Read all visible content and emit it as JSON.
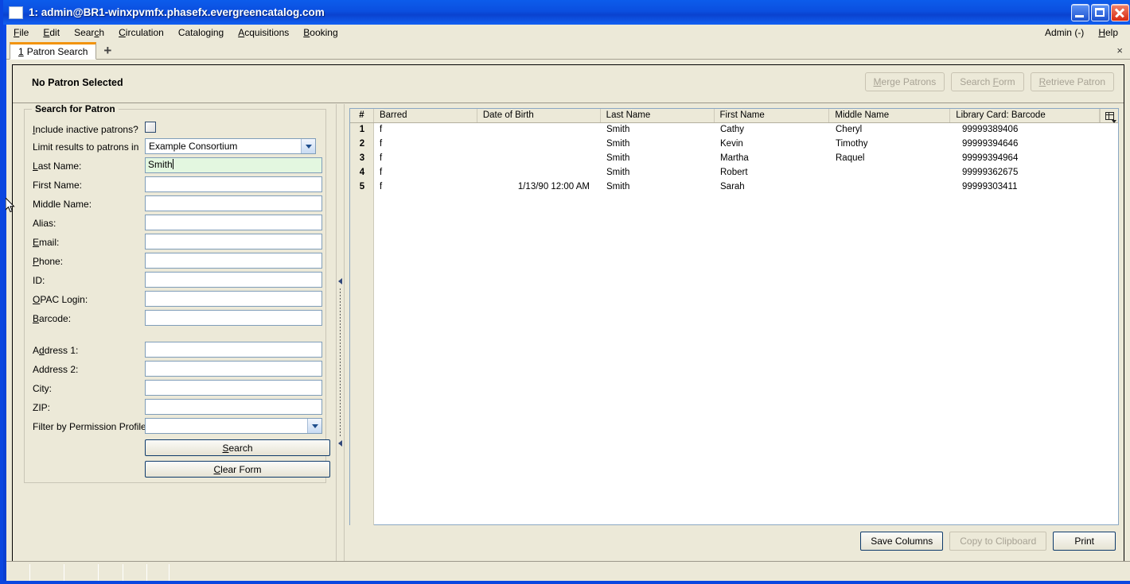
{
  "window": {
    "title": "1: admin@BR1-winxpvmfx.phasefx.evergreencatalog.com",
    "icon": "app-window-icon",
    "minimize": "minimize-icon",
    "maximize": "maximize-icon",
    "close": "close-icon"
  },
  "menubar": {
    "items": [
      {
        "label": "File",
        "accel": "F"
      },
      {
        "label": "Edit",
        "accel": "E"
      },
      {
        "label": "Search",
        "accel": "c"
      },
      {
        "label": "Circulation",
        "accel": "C"
      },
      {
        "label": "Cataloging",
        "accel": "g"
      },
      {
        "label": "Acquisitions",
        "accel": "A"
      },
      {
        "label": "Booking",
        "accel": "B"
      }
    ],
    "right": [
      {
        "label": "Admin (-)"
      },
      {
        "label": "Help",
        "accel": "H"
      }
    ]
  },
  "tabs": {
    "active": "1 Patron Search",
    "active_number": "1",
    "active_label": "Patron Search",
    "add_label": "+",
    "close_label": "×"
  },
  "patron_header": {
    "title": "No Patron Selected",
    "buttons": [
      {
        "label": "Merge Patrons",
        "enabled": false
      },
      {
        "label": "Search Form",
        "enabled": false
      },
      {
        "label": "Retrieve Patron",
        "enabled": false
      }
    ]
  },
  "search_form": {
    "legend": "Search for Patron",
    "fields": [
      {
        "name": "include-inactive",
        "label": "Include inactive patrons?",
        "type": "checkbox",
        "checked": false
      },
      {
        "name": "limit-results",
        "label": "Limit results to patrons in",
        "type": "select",
        "value": "Example Consortium"
      },
      {
        "name": "last-name",
        "label": "Last Name:",
        "type": "text",
        "value": "Smith",
        "focused": true
      },
      {
        "name": "first-name",
        "label": "First Name:",
        "type": "text",
        "value": ""
      },
      {
        "name": "middle-name",
        "label": "Middle Name:",
        "type": "text",
        "value": ""
      },
      {
        "name": "alias",
        "label": "Alias:",
        "type": "text",
        "value": ""
      },
      {
        "name": "email",
        "label": "Email:",
        "type": "text",
        "value": ""
      },
      {
        "name": "phone",
        "label": "Phone:",
        "type": "text",
        "value": ""
      },
      {
        "name": "id",
        "label": "ID:",
        "type": "text",
        "value": ""
      },
      {
        "name": "opac-login",
        "label": "OPAC Login:",
        "type": "text",
        "value": ""
      },
      {
        "name": "barcode",
        "label": "Barcode:",
        "type": "text",
        "value": ""
      },
      {
        "name": "address-1",
        "label": "Address 1:",
        "type": "text",
        "value": ""
      },
      {
        "name": "address-2",
        "label": "Address 2:",
        "type": "text",
        "value": ""
      },
      {
        "name": "city",
        "label": "City:",
        "type": "text",
        "value": ""
      },
      {
        "name": "zip",
        "label": "ZIP:",
        "type": "text",
        "value": ""
      },
      {
        "name": "permission-profile",
        "label": "Filter by Permission Profile:",
        "type": "select",
        "value": ""
      }
    ],
    "search_button": "Search",
    "clear_button": "Clear Form"
  },
  "results": {
    "columns": [
      "#",
      "Barred",
      "Date of Birth",
      "Last Name",
      "First Name",
      "Middle Name",
      "Library Card: Barcode"
    ],
    "column_picker_icon": "column-picker-icon",
    "rows": [
      {
        "num": "1",
        "barred": "f",
        "dob": "",
        "last": "Smith",
        "first": "Cathy",
        "middle": "Cheryl",
        "barcode": "99999389406"
      },
      {
        "num": "2",
        "barred": "f",
        "dob": "",
        "last": "Smith",
        "first": "Kevin",
        "middle": "Timothy",
        "barcode": "99999394646"
      },
      {
        "num": "3",
        "barred": "f",
        "dob": "",
        "last": "Smith",
        "first": "Martha",
        "middle": "Raquel",
        "barcode": "99999394964"
      },
      {
        "num": "4",
        "barred": "f",
        "dob": "",
        "last": "Smith",
        "first": "Robert",
        "middle": "",
        "barcode": "99999362675"
      },
      {
        "num": "5",
        "barred": "f",
        "dob": "1/13/90 12:00 AM",
        "last": "Smith",
        "first": "Sarah",
        "middle": "",
        "barcode": "99999303411"
      }
    ],
    "buttons": [
      {
        "label": "Save Columns",
        "enabled": true
      },
      {
        "label": "Copy to Clipboard",
        "enabled": false
      },
      {
        "label": "Print",
        "enabled": true
      }
    ]
  },
  "statusbar": {
    "cells": [
      "",
      "",
      "",
      "",
      "",
      "",
      ""
    ]
  },
  "colors": {
    "titlebar": "#0b4fe0",
    "chrome": "#ece9d8",
    "active_tab_accent": "#f2930d",
    "focused_field": "#e3f7e0",
    "field_border": "#7f9db9"
  }
}
